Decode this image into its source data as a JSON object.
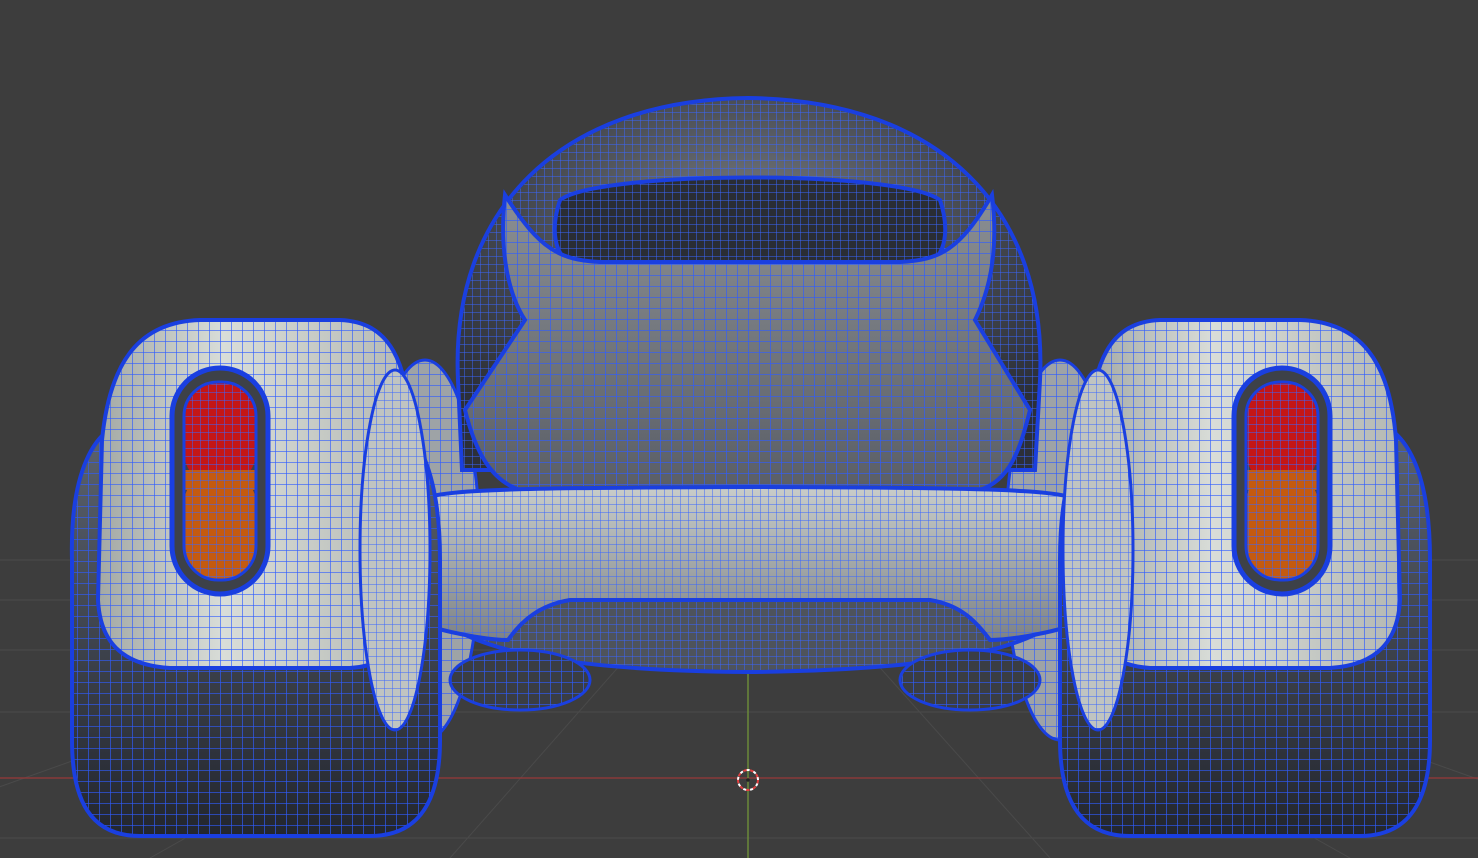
{
  "viewport": {
    "mode": "wireframe-overlay",
    "shading": "solid"
  },
  "colors": {
    "background": "#3d3d3d",
    "grid_line": "#4a4a4a",
    "x_axis": "#8a3a3a",
    "z_axis": "#6b8a3a",
    "wire": "#2f5cff",
    "wire_dark": "#1a3fe0",
    "body_light": "#d9ddd8",
    "body_mid": "#a3a8a4",
    "body_shadow": "#3a3d44",
    "tail_red": "#c41616",
    "tail_orange": "#c45a10",
    "cursor_red": "#e04040"
  },
  "icons": {
    "cursor": "3d-cursor-icon"
  }
}
